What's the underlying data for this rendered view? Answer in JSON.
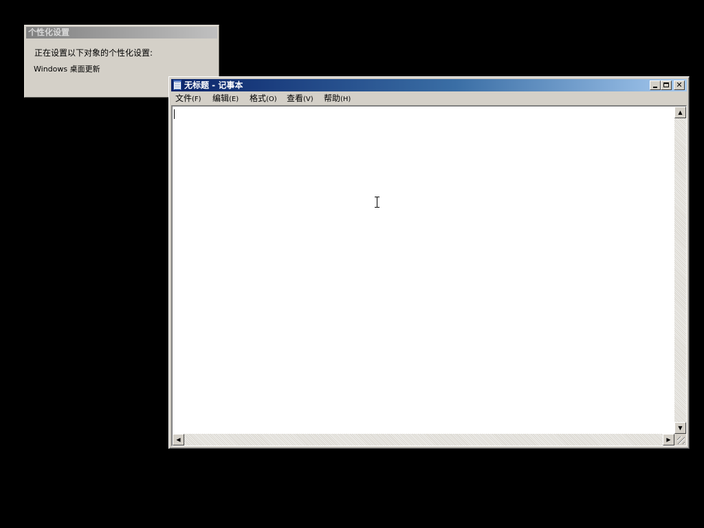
{
  "personalization_dialog": {
    "title": "个性化设置",
    "message": "正在设置以下对象的个性化设置:",
    "item": "Windows 桌面更新"
  },
  "notepad": {
    "title": "无标题 - 记事本",
    "menu": [
      {
        "label": "文件",
        "accel": "(F)"
      },
      {
        "label": "编辑",
        "accel": "(E)"
      },
      {
        "label": "格式",
        "accel": "(O)"
      },
      {
        "label": "查看",
        "accel": "(V)"
      },
      {
        "label": "帮助",
        "accel": "(H)"
      }
    ],
    "content": "",
    "colors": {
      "titlebar_start": "#0a246a",
      "titlebar_end": "#a6caf0",
      "window_face": "#d4d0c8"
    },
    "icons": [
      "notepad-icon",
      "minimize-icon",
      "maximize-icon",
      "close-icon",
      "scroll-up-icon",
      "scroll-down-icon",
      "scroll-left-icon",
      "scroll-right-icon",
      "size-grip-icon"
    ]
  }
}
